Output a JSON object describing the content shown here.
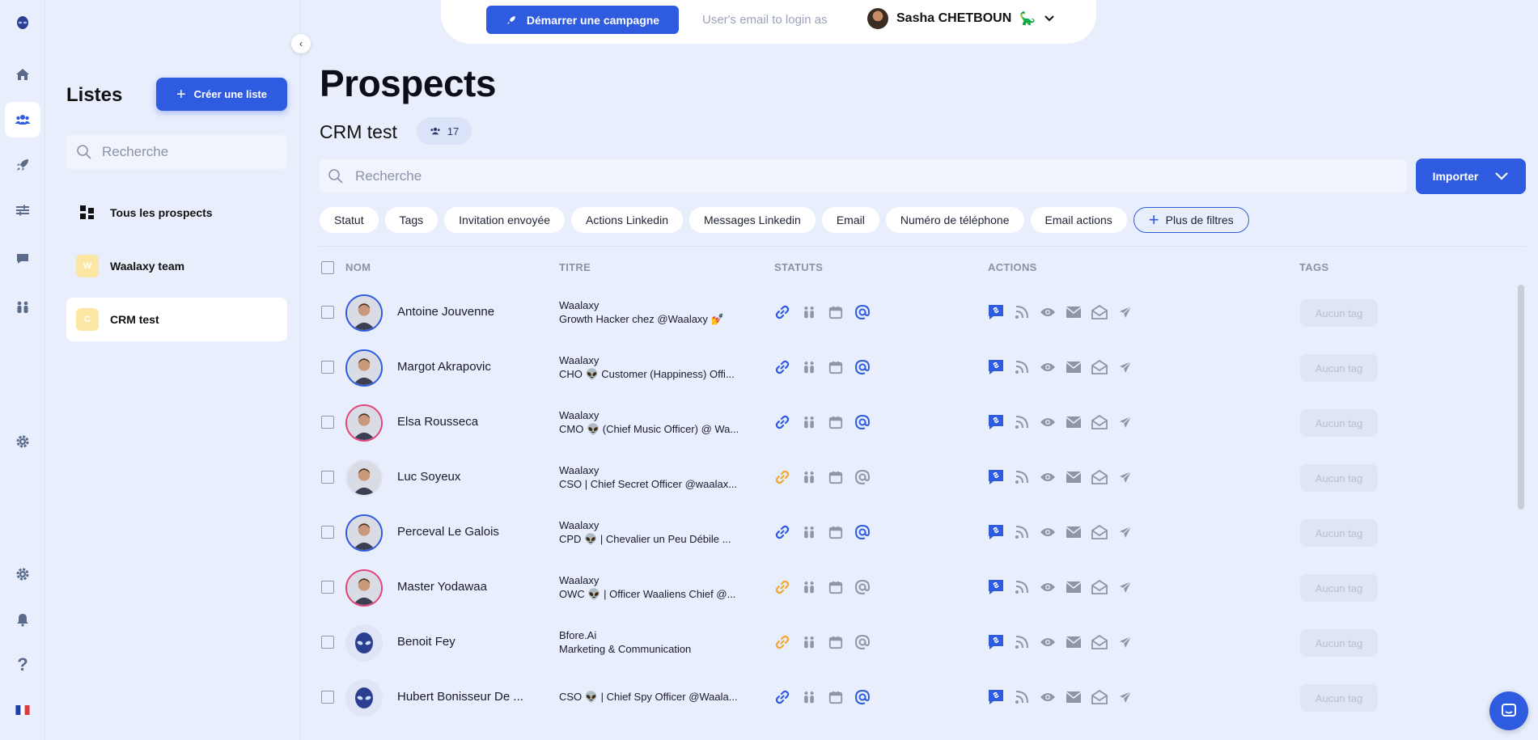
{
  "colors": {
    "accent": "#2f5be0",
    "link_active": "#2f5be0",
    "link_pending": "#f0a830",
    "icon_muted": "#8d95a8"
  },
  "rail": {
    "items": [
      "logo-icon",
      "home-icon",
      "users-icon",
      "rocket-icon",
      "sliders-icon",
      "chat-icon",
      "group-icon",
      "settings-icon",
      "settings-icon",
      "bell-icon",
      "help-icon",
      "flag-fr-icon"
    ],
    "help_glyph": "?"
  },
  "lists_panel": {
    "title": "Listes",
    "create_button": "Créer une liste",
    "search_placeholder": "Recherche",
    "items": [
      {
        "label": "Tous les prospects",
        "letter": ""
      },
      {
        "label": "Waalaxy team",
        "letter": "W"
      },
      {
        "label": "CRM test",
        "letter": "C"
      }
    ],
    "active_index": 2
  },
  "topbar": {
    "campaign_button": "Démarrer une campagne",
    "login_as": "User's email to login as",
    "user_name": "Sasha CHETBOUN",
    "user_emoji": "🦕"
  },
  "main": {
    "title": "Prospects",
    "list_name": "CRM test",
    "count": "17",
    "search_placeholder": "Recherche",
    "import_button": "Importer",
    "filters": [
      "Statut",
      "Tags",
      "Invitation envoyée",
      "Actions Linkedin",
      "Messages Linkedin",
      "Email",
      "Numéro de téléphone",
      "Email actions"
    ],
    "more_filters": "Plus de filtres"
  },
  "table": {
    "columns": {
      "name": "NOM",
      "title": "TITRE",
      "statuses": "STATUTS",
      "actions": "ACTIONS",
      "tags": "TAGS"
    },
    "rows": [
      {
        "name": "Antoine Jouvenne",
        "company": "Waalaxy",
        "role": "Growth Hacker chez @Waalaxy 💅",
        "link": "active",
        "email": "active",
        "avatar": "blue"
      },
      {
        "name": "Margot Akrapovic",
        "company": "Waalaxy",
        "role": "CHO 👽 Customer (Happiness) Offi...",
        "link": "active",
        "email": "active",
        "avatar": "blue"
      },
      {
        "name": "Elsa Rousseca",
        "company": "Waalaxy",
        "role": "CMO 👽 (Chief Music Officer) @ Wa...",
        "link": "active",
        "email": "active",
        "avatar": "pink"
      },
      {
        "name": "Luc Soyeux",
        "company": "Waalaxy",
        "role": "CSO | Chief Secret Officer @waalax...",
        "link": "pending",
        "email": "muted",
        "avatar": "none"
      },
      {
        "name": "Perceval Le Galois",
        "company": "Waalaxy",
        "role": "CPD 👽 | Chevalier un Peu Débile ...",
        "link": "active",
        "email": "active",
        "avatar": "blue"
      },
      {
        "name": "Master Yodawaa",
        "company": "Waalaxy",
        "role": "OWC 👽 | Officer Waaliens Chief @...",
        "link": "pending",
        "email": "muted",
        "avatar": "pink"
      },
      {
        "name": "Benoit Fey",
        "company": "Bfore.Ai",
        "role": "Marketing & Communication",
        "link": "pending",
        "email": "muted",
        "avatar": "alien"
      },
      {
        "name": "Hubert Bonisseur De ...",
        "company": "",
        "role": "CSO 👽 | Chief Spy Officer @Waala...",
        "link": "active",
        "email": "active",
        "avatar": "alien"
      }
    ],
    "tag_label": "Aucun tag"
  }
}
